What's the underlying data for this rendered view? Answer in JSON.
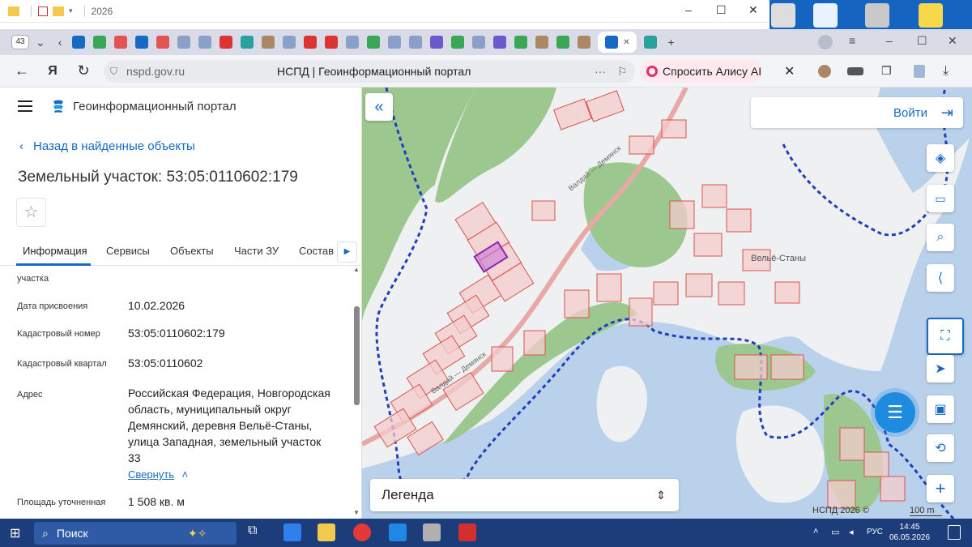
{
  "explorer": {
    "path_label": "2026"
  },
  "browser": {
    "tab_count": "43",
    "url": "nspd.gov.ru",
    "page_title": "НСПД | Геоинформационный портал",
    "alice_label": "Спросить Алису AI"
  },
  "app": {
    "title": "Геоинформационный портал",
    "back_link": "Назад в найденные объекты",
    "object_title": "Земельный участок: 53:05:0110602:179",
    "tabs": [
      "Информация",
      "Сервисы",
      "Объекты",
      "Части ЗУ",
      "Состав"
    ],
    "rows": [
      {
        "label": "участка",
        "value": ""
      },
      {
        "label": "Дата присвоения",
        "value": "10.02.2026"
      },
      {
        "label": "Кадастровый номер",
        "value": "53:05:0110602:179"
      },
      {
        "label": "Кадастровый квартал",
        "value": "53:05:0110602"
      },
      {
        "label": "Адрес",
        "value": "Российская Федерация, Новгородская область, муниципальный округ Демянский, деревня Вельё-Станы, улица Западная, земельный участок 33"
      },
      {
        "label": "Площадь уточненная",
        "value": "1 508 кв. м"
      }
    ],
    "collapse_label": "Свернуть"
  },
  "map": {
    "login_label": "Войти",
    "legend_label": "Легенда",
    "village_label": "Вельё-Станы",
    "road_label": "Валдай — Демянск",
    "copyright": "НСПД 2026 ©",
    "scale": "100 m",
    "colors": {
      "water": "#b9d1ea",
      "forest": "#9cc78f",
      "parcel_fill": "#f6cccc",
      "parcel_edge": "#d9534f",
      "boundary": "#1f3fbf",
      "selected": "#c77ad6"
    }
  },
  "taskbar": {
    "search_label": "Поиск",
    "lang": "РУС",
    "time": "14:45",
    "date": "06.05.2026"
  }
}
